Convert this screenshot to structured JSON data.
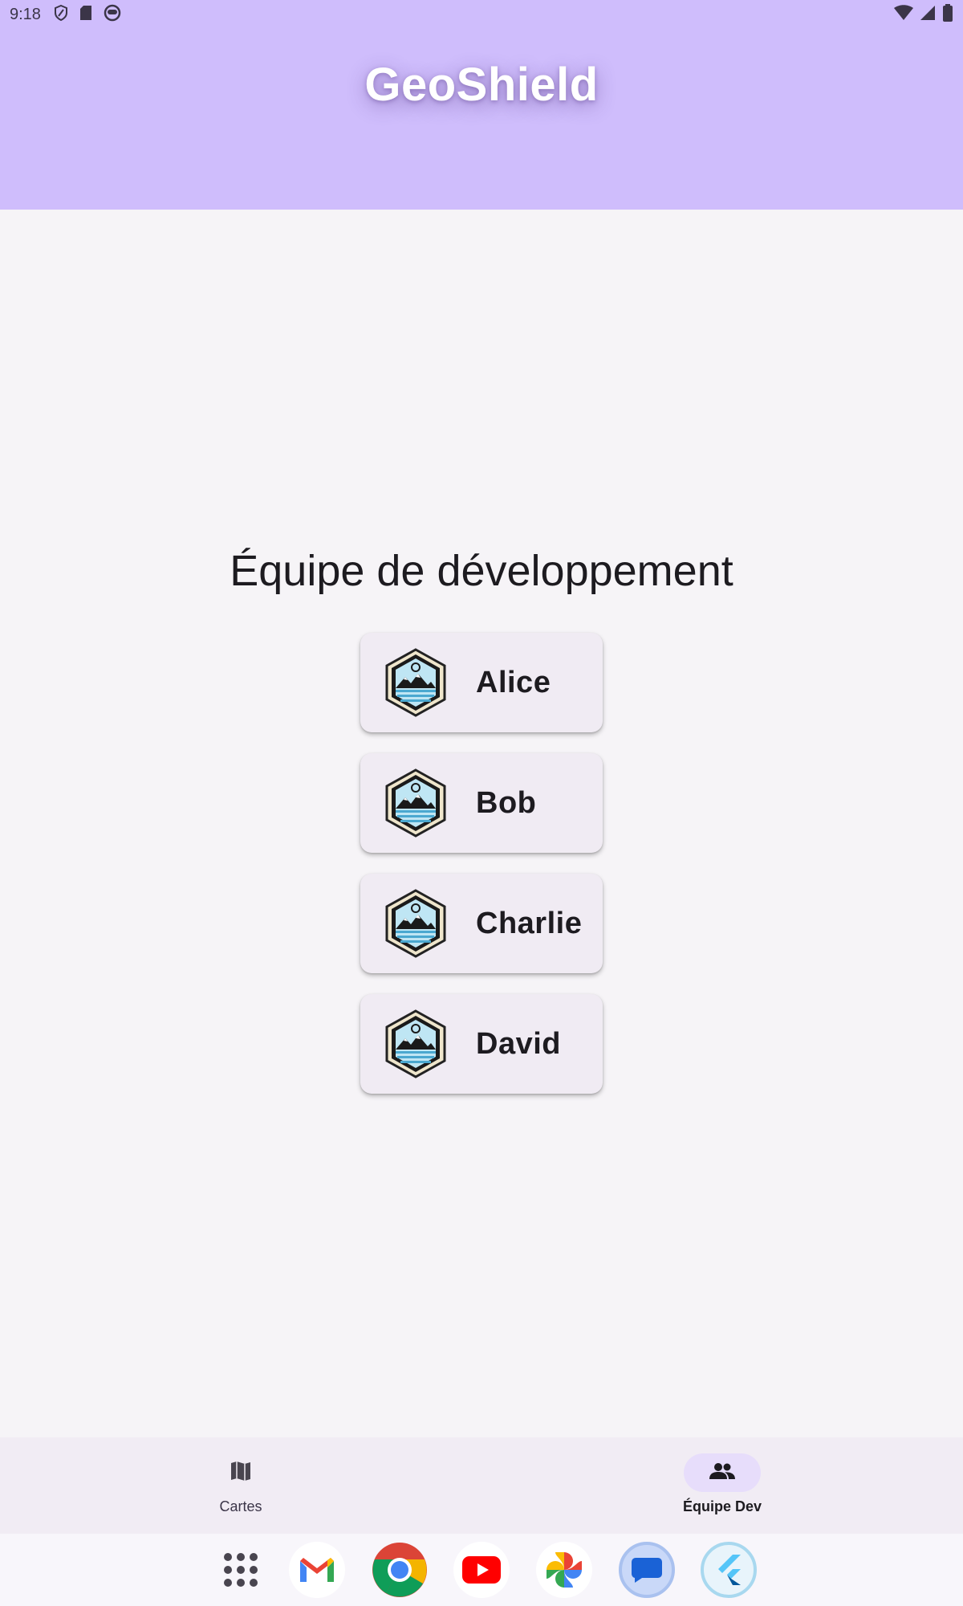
{
  "status_bar": {
    "time": "9:18"
  },
  "app": {
    "title": "GeoShield"
  },
  "main": {
    "heading": "Équipe de développement",
    "members": [
      {
        "name": "Alice"
      },
      {
        "name": "Bob"
      },
      {
        "name": "Charlie"
      },
      {
        "name": "David"
      }
    ]
  },
  "bottom_nav": {
    "items": [
      {
        "label": "Cartes",
        "icon": "map-icon",
        "selected": false
      },
      {
        "label": "Équipe Dev",
        "icon": "people-icon",
        "selected": true
      }
    ]
  },
  "dock": {
    "apps": [
      "app-drawer-icon",
      "gmail-icon",
      "chrome-icon",
      "youtube-icon",
      "photos-icon",
      "messages-icon",
      "flutter-icon"
    ]
  },
  "colors": {
    "header": "#cfbdfc",
    "background": "#f6f4f7",
    "card": "#f0ebf3",
    "nav_selected": "#e7ddfb"
  }
}
